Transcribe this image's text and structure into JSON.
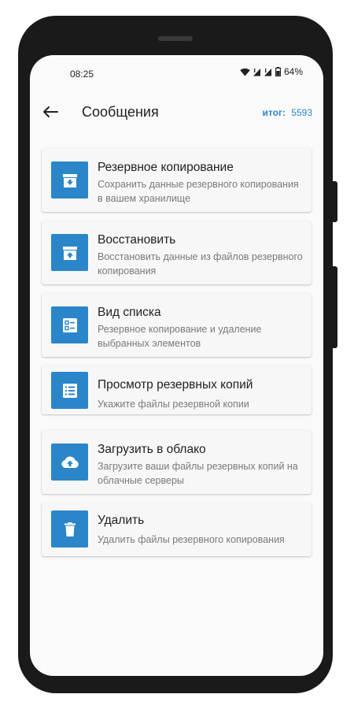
{
  "status_bar": {
    "time": "08:25",
    "battery": "64%"
  },
  "header": {
    "title": "Сообщения",
    "total_label": "итог:",
    "total_value": "5593"
  },
  "items": [
    {
      "title": "Резервное копирование",
      "subtitle": "Сохранить данные резервного копирования в вашем хранилище",
      "icon": "archive-download-icon"
    },
    {
      "title": "Восстановить",
      "subtitle": "Восстановить данные из файлов резервного копирования",
      "icon": "archive-upload-icon"
    },
    {
      "title": "Вид списка",
      "subtitle": "Резервное копирование и удаление выбранных элементов",
      "icon": "checklist-icon"
    },
    {
      "title": "Просмотр резервных копий",
      "subtitle": "Укажите файлы резервной копии",
      "icon": "list-icon"
    },
    {
      "title": "Загрузить в облако",
      "subtitle": "Загрузите ваши файлы резервных копий на облачные серверы",
      "icon": "cloud-upload-icon"
    },
    {
      "title": "Удалить",
      "subtitle": "Удалить файлы резервного копирования",
      "icon": "trash-icon"
    }
  ],
  "colors": {
    "accent": "#2a86c9",
    "background": "#fafafa",
    "card": "#f7f7f7"
  }
}
